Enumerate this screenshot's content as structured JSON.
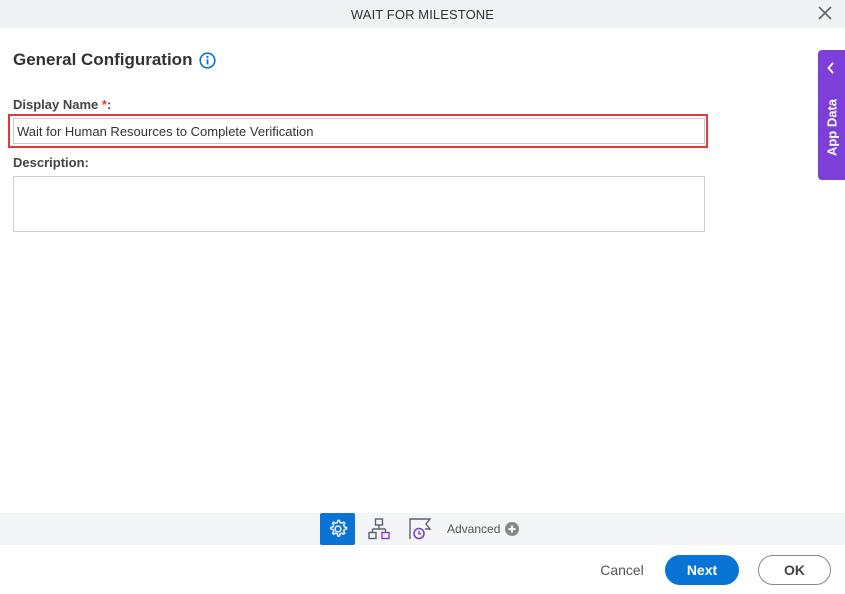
{
  "dialog": {
    "title": "WAIT FOR MILESTONE",
    "close_icon": "close-icon"
  },
  "section": {
    "title": "General Configuration",
    "info_icon": "info-icon"
  },
  "fields": {
    "display_name": {
      "label": "Display Name ",
      "required_mark": "*",
      "suffix": ":",
      "value": "Wait for Human Resources to Complete Verification"
    },
    "description": {
      "label": "Description:",
      "value": ""
    }
  },
  "app_data": {
    "label": "App Data",
    "icon": "chevron-left-icon"
  },
  "toolbar": {
    "items": [
      {
        "name": "general-configuration",
        "icon": "gear-icon",
        "active": true
      },
      {
        "name": "milestone-hierarchy",
        "icon": "hierarchy-icon",
        "active": false
      },
      {
        "name": "milestone-timer",
        "icon": "flag-clock-icon",
        "active": false
      }
    ],
    "advanced_label": "Advanced",
    "advanced_icon": "plus-circle-icon"
  },
  "footer": {
    "cancel_label": "Cancel",
    "next_label": "Next",
    "ok_label": "OK"
  },
  "colors": {
    "primary": "#0a73d6",
    "app_data": "#7c3fd8",
    "highlight": "#e0393e"
  }
}
